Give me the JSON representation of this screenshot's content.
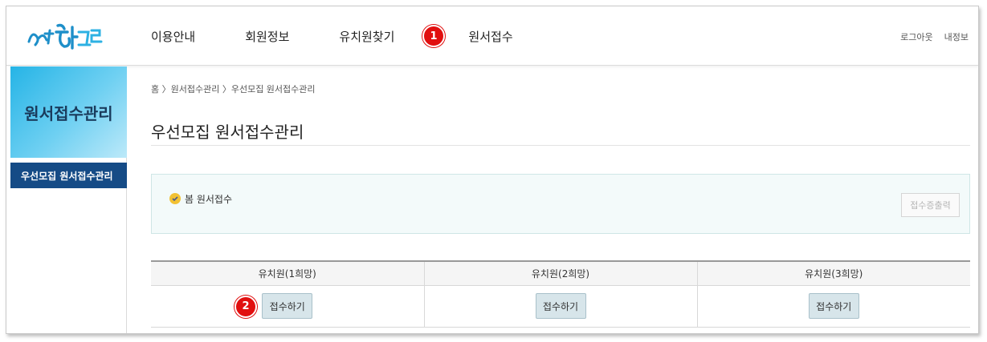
{
  "header": {
    "nav": [
      "이용안내",
      "회원정보",
      "유치원찾기",
      "원서접수"
    ],
    "step1_badge": "1",
    "util": [
      "로그아웃",
      "내정보"
    ]
  },
  "sidebar": {
    "title": "원서접수관리",
    "items": [
      "우선모집 원서접수관리"
    ]
  },
  "main": {
    "breadcrumb": "홈 〉원서접수관리 〉우선모집 원서접수관리",
    "title": "우선모집 원서접수관리",
    "notice_label": "봄 원서접수",
    "print_button": "접수증출력",
    "table": {
      "headers": [
        "유치원(1희망)",
        "유치원(2희망)",
        "유치원(3희망)"
      ],
      "buttons": [
        "접수하기",
        "접수하기",
        "접수하기"
      ]
    },
    "step2_badge": "2"
  },
  "colors": {
    "brand_blue": "#154b86",
    "accent_red": "#e10f0f",
    "sidebar_gradient_start": "#25b4e6"
  }
}
